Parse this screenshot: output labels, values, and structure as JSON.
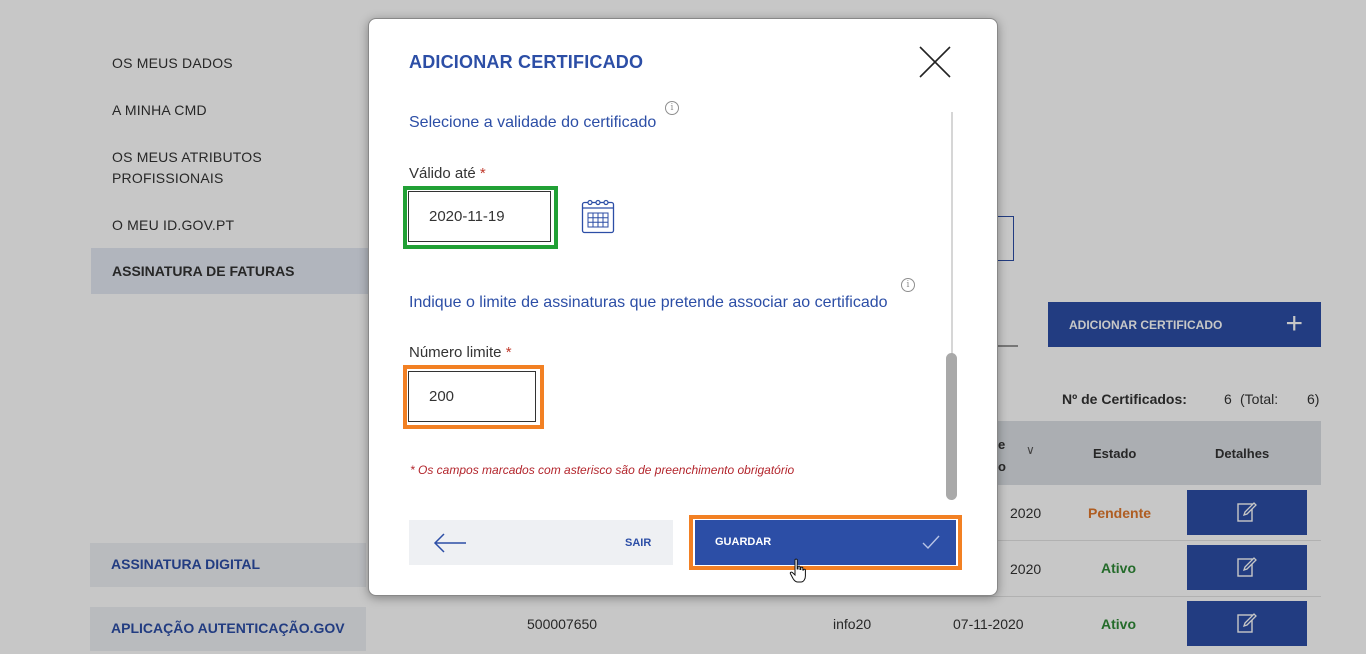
{
  "sidebar": {
    "items": [
      {
        "label": "OS MEUS DADOS"
      },
      {
        "label": "A MINHA CMD"
      },
      {
        "label": "OS MEUS ATRIBUTOS PROFISSIONAIS"
      },
      {
        "label": "O MEU ID.GOV.PT"
      }
    ],
    "active_label": "ASSINATURA DE FATURAS",
    "bottom_items": [
      {
        "label": "ASSINATURA DIGITAL"
      },
      {
        "label": "APLICAÇÃO AUTENTICAÇÃO.GOV"
      }
    ]
  },
  "background": {
    "add_certificate_label": "ADICIONAR CERTIFICADO",
    "count_label": "Nº de Certificados:",
    "count_value": "6",
    "count_total_label": "(Total:",
    "count_total_value": "6)",
    "table": {
      "header_partial": "e\no",
      "header_estado": "Estado",
      "header_detalhes": "Detalhes",
      "rows": [
        {
          "number": "",
          "name": "",
          "date": "2020",
          "status": "Pendente",
          "status_color": "#e0782c"
        },
        {
          "number": "",
          "name": "",
          "date": "2020",
          "status": "Ativo",
          "status_color": "#2f8a37"
        },
        {
          "number": "500007650",
          "name": "info20",
          "date": "07-11-2020",
          "status": "Ativo",
          "status_color": "#2f8a37"
        }
      ]
    }
  },
  "modal": {
    "title": "ADICIONAR CERTIFICADO",
    "validity_section_title": "Selecione a validade do certificado",
    "valid_until_label": "Válido até",
    "required_marker": "*",
    "valid_until_value": "2020-11-19",
    "limit_section_title": "Indique o limite de assinaturas que pretende associar ao certificado",
    "limit_label": "Número limite",
    "limit_value": "200",
    "required_note": "* Os campos marcados com asterisco são de preenchimento obrigatório",
    "info_glyph": "i",
    "exit_label": "SAIR",
    "save_label": "GUARDAR"
  },
  "colors": {
    "primary": "#2c4ea6",
    "highlight_green": "#21a035",
    "highlight_orange": "#f28023",
    "required_red": "#b3252c"
  },
  "icons": {
    "close": "close-icon",
    "calendar": "calendar-icon",
    "info": "info-icon",
    "back": "arrow-left-icon",
    "check": "checkmark-icon",
    "edit": "edit-icon",
    "plus": "plus-icon",
    "cursor": "hand-pointer-icon"
  }
}
